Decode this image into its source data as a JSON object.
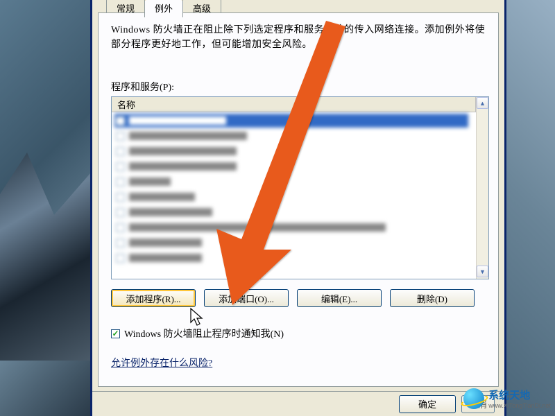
{
  "tabs": {
    "general": "常规",
    "exceptions": "例外",
    "advanced": "高级"
  },
  "description": "Windows 防火墙正在阻止除下列选定程序和服务之外的传入网络连接。添加例外将使部分程序更好地工作，但可能增加安全风险。",
  "list_label": "程序和服务(P):",
  "list_header": "名称",
  "buttons": {
    "add_program": "添加程序(R)...",
    "add_port": "添加端口(O)...",
    "edit": "编辑(E)...",
    "delete": "删除(D)"
  },
  "notify_label": "Windows 防火墙阻止程序时通知我(N)",
  "risk_link": "允许例外存在什么风险?",
  "bottom": {
    "ok": "确定",
    "cancel": "取消"
  },
  "watermark": {
    "title": "系统天地",
    "url": "www.XiTongTianDi.net"
  }
}
